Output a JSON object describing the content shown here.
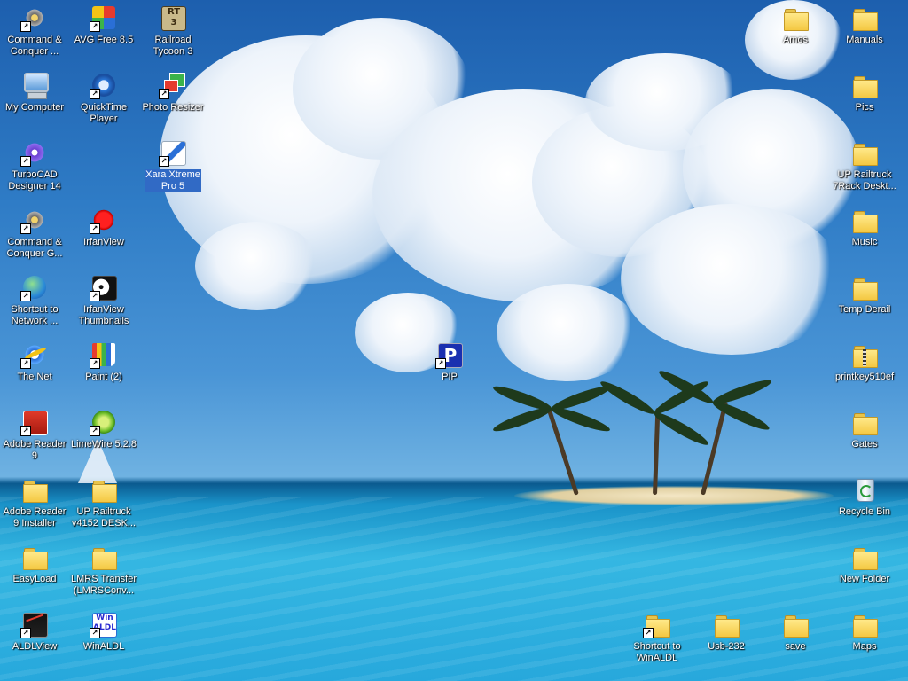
{
  "window_title": "Desktop",
  "colors": {
    "selection": "#316ac5",
    "folder": "#f4c842"
  },
  "icons": {
    "cnc1": {
      "label": "Command &\nConquer ...",
      "icon": "soldier-icon"
    },
    "avg": {
      "label": "AVG Free 8.5",
      "icon": "avg-icon"
    },
    "rt3": {
      "label": "Railroad\nTycoon 3",
      "icon": "rt3-icon"
    },
    "mycomputer": {
      "label": "My Computer",
      "icon": "computer-icon"
    },
    "quicktime": {
      "label": "QuickTime\nPlayer",
      "icon": "quicktime-icon"
    },
    "photoresizer": {
      "label": "Photo Resizer",
      "icon": "photo-resizer-icon"
    },
    "turbocad": {
      "label": "TurboCAD\nDesigner 14",
      "icon": "gear-icon"
    },
    "xara": {
      "label": "Xara Xtreme\nPro 5",
      "icon": "xara-icon"
    },
    "cnc2": {
      "label": "Command &\nConquer G...",
      "icon": "soldier-icon"
    },
    "irfanview": {
      "label": "IrfanView",
      "icon": "irfanview-icon"
    },
    "network": {
      "label": "Shortcut to\nNetwork ...",
      "icon": "network-icon"
    },
    "irfanthumbs": {
      "label": "IrfanView\nThumbnails",
      "icon": "panda-icon"
    },
    "thenet": {
      "label": "The Net",
      "icon": "internet-explorer-icon"
    },
    "paint": {
      "label": "Paint (2)",
      "icon": "paint-icon"
    },
    "pip": {
      "label": "PIP",
      "icon": "pip-icon"
    },
    "adobereader": {
      "label": "Adobe Reader\n9",
      "icon": "adobe-reader-icon"
    },
    "limewire": {
      "label": "LimeWire 5.2.8",
      "icon": "limewire-icon"
    },
    "adobeinstaller": {
      "label": "Adobe Reader\n9 Installer",
      "icon": "folder-icon"
    },
    "upv4152": {
      "label": "UP Railtruck\nv4152 DESK...",
      "icon": "folder-icon"
    },
    "easyload": {
      "label": "EasyLoad",
      "icon": "folder-icon"
    },
    "lmrs": {
      "label": "LMRS Transfer\n(LMRSConv...",
      "icon": "folder-icon"
    },
    "aldlview": {
      "label": "ALDLView",
      "icon": "aldl-view-icon"
    },
    "winaldl": {
      "label": "WinALDL",
      "icon": "winaldl-icon"
    },
    "shortcutwinaldl": {
      "label": "Shortcut to\nWinALDL",
      "icon": "folder-icon"
    },
    "usb232": {
      "label": "Usb-232",
      "icon": "folder-icon"
    },
    "save": {
      "label": "save",
      "icon": "folder-icon"
    },
    "maps": {
      "label": "Maps",
      "icon": "folder-icon"
    },
    "amos": {
      "label": "Amos",
      "icon": "folder-icon"
    },
    "manuals": {
      "label": "Manuals",
      "icon": "folder-icon"
    },
    "pics": {
      "label": "Pics",
      "icon": "folder-icon"
    },
    "up7rack": {
      "label": "UP Railtruck\n7Rack Deskt...",
      "icon": "folder-icon"
    },
    "music": {
      "label": "Music",
      "icon": "folder-icon"
    },
    "tempderail": {
      "label": "Temp Derail",
      "icon": "folder-icon"
    },
    "printkey": {
      "label": "printkey510ef",
      "icon": "zip-folder-icon"
    },
    "gates": {
      "label": "Gates",
      "icon": "folder-icon"
    },
    "recyclebin": {
      "label": "Recycle Bin",
      "icon": "recycle-bin-icon"
    },
    "newfolder": {
      "label": "New Folder",
      "icon": "folder-icon"
    }
  }
}
